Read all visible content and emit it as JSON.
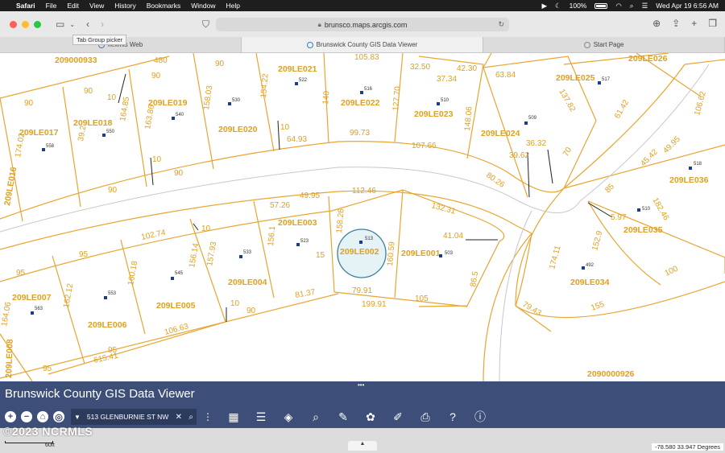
{
  "menubar": {
    "app": "Safari",
    "items": [
      "File",
      "Edit",
      "View",
      "History",
      "Bookmarks",
      "Window",
      "Help"
    ],
    "battery": "100%",
    "datetime": "Wed Apr 19  6:56 AM"
  },
  "browser": {
    "url": "brunsco.maps.arcgis.com",
    "tooltip": "Tab Group picker",
    "tabs": [
      "flexmls Web",
      "Brunswick County GIS Data Viewer",
      "Start Page"
    ]
  },
  "map": {
    "parcel_ids": [
      "209000933",
      "209LE017",
      "209LE018",
      "209LE019",
      "209LE020",
      "209LE021",
      "209LE022",
      "209LE023",
      "209LE024",
      "209LE025",
      "209LE026",
      "209LE016",
      "209LE036",
      "209LE003",
      "209LE002",
      "209LE001",
      "209LE004",
      "209LE005",
      "209LE006",
      "209LE007",
      "209LE035",
      "209LE034",
      "2090000926",
      "209LE008"
    ],
    "addresses": [
      "558",
      "550",
      "540",
      "530",
      "522",
      "516",
      "510",
      "509",
      "517",
      "518",
      "523",
      "513",
      "503",
      "533",
      "545",
      "553",
      "563",
      "510",
      "492"
    ],
    "dimensions": [
      "480",
      "90",
      "90",
      "154.22",
      "158.03",
      "163.86",
      "164.85",
      "39.2",
      "174.02",
      "10",
      "90",
      "90",
      "10",
      "10",
      "64.93",
      "99.73",
      "140",
      "127.70",
      "105.83",
      "32.50",
      "42.30",
      "37.34",
      "148.06",
      "63.84",
      "107.66",
      "80.26",
      "39.62",
      "36.32",
      "70",
      "61.42",
      "137.82",
      "106.62",
      "49.95",
      "45.42",
      "90",
      "90",
      "57.26",
      "49.95",
      "112.46",
      "132.31",
      "41.04",
      "158.26",
      "156.1",
      "15",
      "160.59",
      "86.5",
      "105",
      "79.91",
      "199.91",
      "81.37",
      "90",
      "10",
      "157.93",
      "156.14",
      "10",
      "102.74",
      "95",
      "95",
      "160.18",
      "162.12",
      "164.06",
      "106.63",
      "95",
      "615.41",
      "95",
      "85",
      "5.97",
      "182.46",
      "152.9",
      "174.11",
      "100",
      "155",
      "79.43"
    ]
  },
  "gis": {
    "title": "Brunswick County GIS Data Viewer",
    "search_value": "513 GLENBURNIE ST NW",
    "tools": [
      "basemap-gallery",
      "legend",
      "layers",
      "query",
      "measure-draw",
      "print-widgets",
      "select",
      "print",
      "help",
      "about"
    ]
  },
  "footer": {
    "watermark": "©2023 NCRMLS",
    "scale_label": "60ft",
    "coordinates": "-78.580 33.947 Degrees"
  }
}
